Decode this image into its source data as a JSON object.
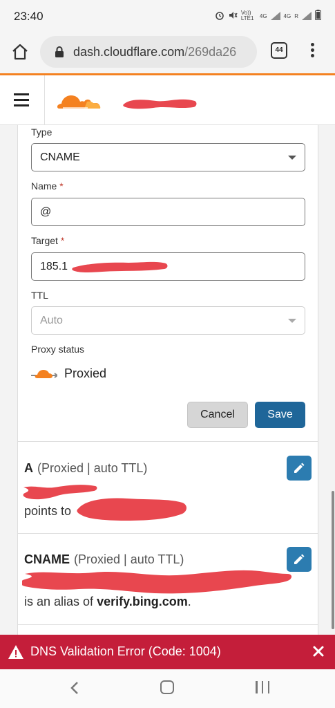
{
  "status_bar": {
    "time": "23:40",
    "icons": [
      "alarm-icon",
      "mute-icon",
      "volte-icon",
      "signal-icon",
      "signal-icon",
      "battery-icon"
    ],
    "network1": "Vo)) LTE1",
    "network2": "4G",
    "network3": "4G",
    "network4": "R"
  },
  "browser": {
    "url_domain": "dash.cloudflare.com",
    "url_path": "/269da26",
    "tab_count": "44"
  },
  "header": {
    "logo": "cloudflare-logo",
    "account_name": ""
  },
  "edit_form": {
    "type": {
      "label": "Type",
      "value": "CNAME"
    },
    "name": {
      "label": "Name",
      "required_mark": "*",
      "value": "@"
    },
    "target": {
      "label": "Target",
      "required_mark": "*",
      "value_visible": "185.1"
    },
    "ttl": {
      "label": "TTL",
      "value": "Auto"
    },
    "proxy": {
      "label": "Proxy status",
      "value": "Proxied"
    },
    "cancel_label": "Cancel",
    "save_label": "Save"
  },
  "records": [
    {
      "type": "A",
      "meta": "(Proxied | auto TTL)",
      "line2_prefix": "points to",
      "line2_value": ""
    },
    {
      "type": "CNAME",
      "meta": "(Proxied | auto TTL)",
      "line2_prefix": "is an alias of",
      "line2_value": "verify.bing.com",
      "line2_suffix": "."
    }
  ],
  "error": {
    "message": "DNS Validation Error (Code: 1004)"
  },
  "colors": {
    "cloudflare_orange": "#f48120",
    "save_blue": "#1f6699",
    "edit_blue": "#2c7cb0",
    "error_red": "#c41e3a",
    "redaction": "#e8474f"
  }
}
